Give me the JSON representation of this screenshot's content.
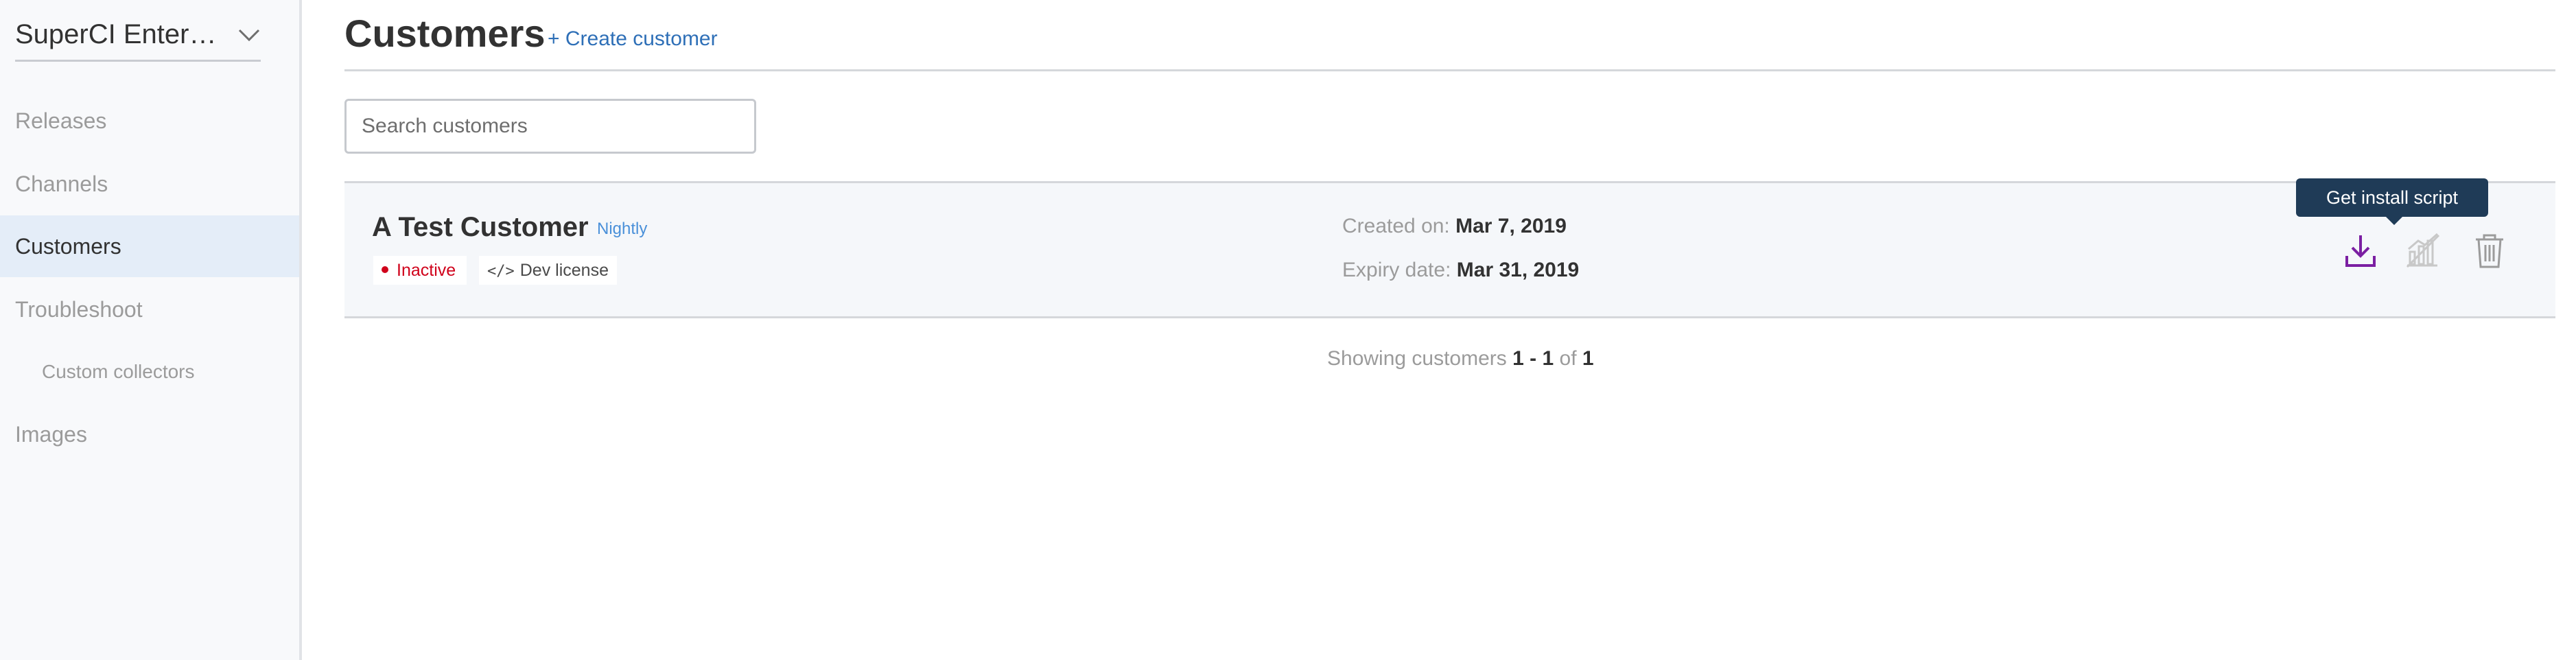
{
  "sidebar": {
    "app_name": "SuperCI Enterprise",
    "items": [
      {
        "label": "Releases"
      },
      {
        "label": "Channels"
      },
      {
        "label": "Customers"
      },
      {
        "label": "Troubleshoot"
      },
      {
        "label": "Custom collectors"
      },
      {
        "label": "Images"
      }
    ]
  },
  "header": {
    "title": "Customers",
    "create_label": "+ Create customer"
  },
  "search": {
    "placeholder": "Search customers",
    "value": ""
  },
  "customers": [
    {
      "name": "A Test Customer",
      "channel": "Nightly",
      "status": "Inactive",
      "license_type": "Dev license",
      "created_label": "Created on:",
      "created_value": "Mar 7, 2019",
      "expiry_label": "Expiry date:",
      "expiry_value": "Mar 31, 2019"
    }
  ],
  "tooltip": {
    "text": "Get install script"
  },
  "pagination": {
    "prefix": "Showing customers",
    "start": "1",
    "separator": "-",
    "end": "1",
    "of_label": "of",
    "total": "1"
  },
  "icons": {
    "download": "download-icon",
    "chart": "chart-disabled-icon",
    "delete": "trash-icon"
  },
  "colors": {
    "accent": "#2e6fb7",
    "status_inactive": "#d0021b",
    "download_icon": "#7b1fa2",
    "tooltip_bg": "#1f3b57",
    "active_nav_bg": "#e4edf8"
  }
}
